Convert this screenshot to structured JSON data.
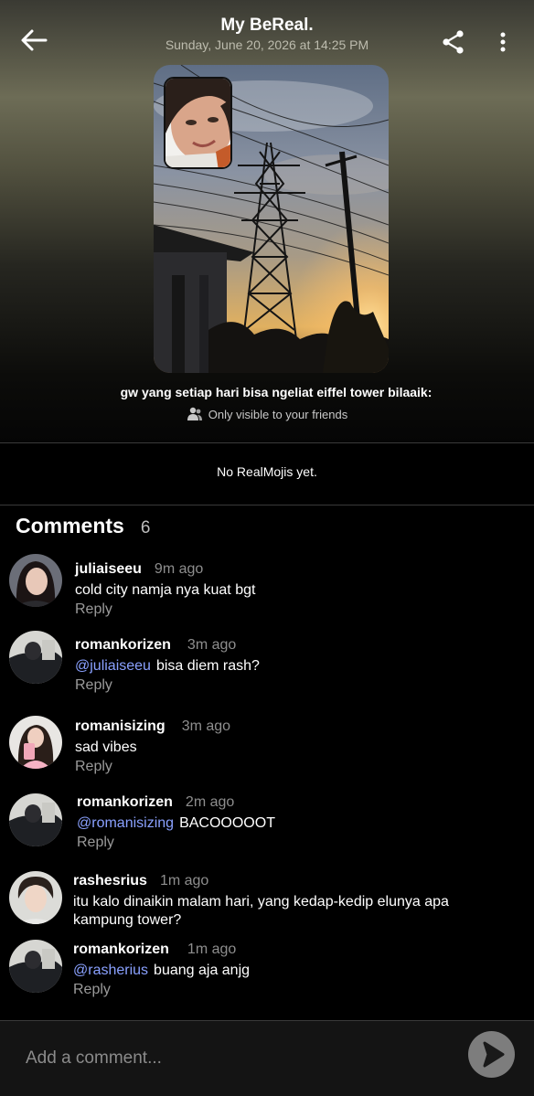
{
  "header": {
    "title": "My BeReal.",
    "subtitle": "Sunday, June 20, 2026 at 14:25 PM",
    "back_icon": "arrow-left-icon",
    "share_icon": "share-icon",
    "more_icon": "more-vertical-icon"
  },
  "post": {
    "caption": "gw yang setiap hari bisa ngeliat eiffel tower bilaaik:",
    "visibility": "Only visible to your friends"
  },
  "realmojis": {
    "empty_text": "No RealMojis yet."
  },
  "comments": {
    "title": "Comments",
    "count": "6",
    "reply_label": "Reply",
    "items": [
      {
        "username": "juliaiseeu",
        "time": "9m ago",
        "mention": "",
        "text": "cold city namja nya kuat bgt",
        "has_reply": true
      },
      {
        "username": "romankorizen",
        "time": "3m ago",
        "mention": "@juliaiseeu",
        "text": "bisa diem rash?",
        "has_reply": true
      },
      {
        "username": "romanisizing",
        "time": "3m ago",
        "mention": "",
        "text": "sad vibes",
        "has_reply": true
      },
      {
        "username": "romankorizen",
        "time": "2m ago",
        "mention": "@romanisizing",
        "text": "BACOOOOOT",
        "has_reply": true
      },
      {
        "username": "rashesrius",
        "time": "1m ago",
        "mention": "",
        "text": "itu kalo dinaikin malam hari, yang kedap-kedip elunya apa kampung tower?",
        "has_reply": false
      },
      {
        "username": "romankorizen",
        "time": "1m ago",
        "mention": "@rasherius",
        "text": "buang aja anjg",
        "has_reply": true
      }
    ]
  },
  "input": {
    "placeholder": "Add a comment...",
    "send_icon": "send-icon"
  },
  "colors": {
    "mention": "#8aa1ff",
    "muted": "#8e8e8e",
    "background": "#000000"
  }
}
